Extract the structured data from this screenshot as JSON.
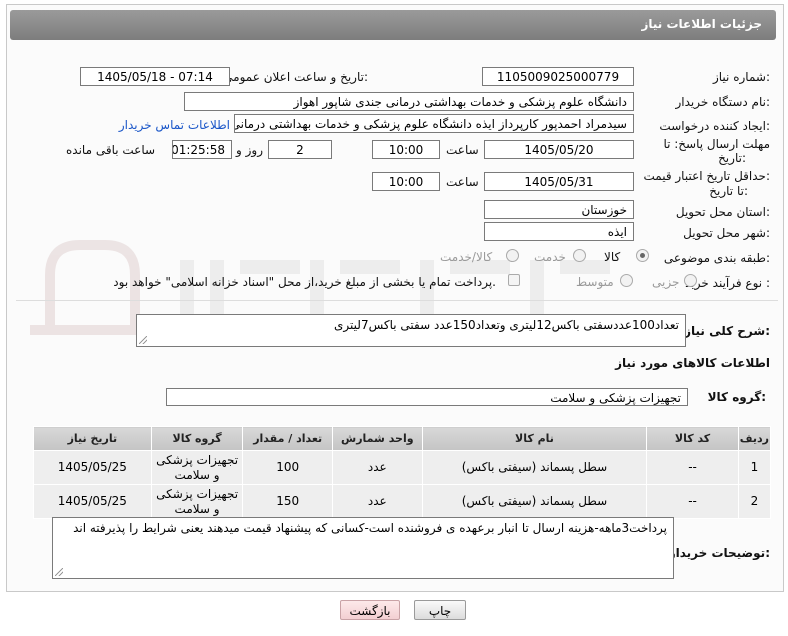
{
  "header": {
    "title": "جزئیات اطلاعات نیاز"
  },
  "fields": {
    "need_number_label": "شماره نیاز:",
    "need_number": "1105009025000779",
    "announce_label": "تاریخ و ساعت اعلان عمومی:",
    "announce_value": "1405/05/18 - 07:14",
    "buyer_org_label": "نام دستگاه خریدار:",
    "buyer_org": "دانشگاه علوم پزشکی و خدمات بهداشتی درمانی جندی شاپور اهواز",
    "requester_label": "ایجاد کننده درخواست:",
    "requester": "سیدمراد احمدپور کارپرداز ایذه دانشگاه علوم پزشکی و خدمات بهداشتی درمانی",
    "contact_link": "اطلاعات تماس خریدار",
    "deadline_label_1": "مهلت ارسال پاسخ: تا",
    "deadline_label_2": "تاریخ:",
    "deadline_date": "1405/05/20",
    "time_label": "ساعت",
    "deadline_time": "10:00",
    "days_value": "2",
    "days_label": "روز و",
    "remaining_time": "01:25:58",
    "remaining_label": "ساعت باقی مانده",
    "validity_label_1": "حداقل تاریخ اعتبار قیمت:",
    "validity_label_2": "تا تاریخ:",
    "validity_date": "1405/05/31",
    "validity_time": "10:00",
    "province_label": "استان محل تحویل:",
    "province": "خوزستان",
    "city_label": "شهر محل تحویل:",
    "city": "ایذه",
    "category_label": "طبقه بندی موضوعی:",
    "category_options": [
      "کالا",
      "خدمت",
      "کالا/خدمت"
    ],
    "process_label": "نوع فرآیند خرید :",
    "process_options": [
      "جزیی",
      "متوسط"
    ],
    "payment_note": "پرداخت تمام یا بخشی از مبلغ خرید،از محل \"اسناد خزانه اسلامی\" خواهد بود."
  },
  "summary": {
    "label": "شرح کلی نیاز:",
    "text": "تعداد100عددسفتی باکس12لیتری وتعداد150عدد سفتی باکس7لیتری"
  },
  "items_section": {
    "title": "اطلاعات کالاهای مورد نیاز",
    "group_label": "گروه کالا:",
    "group_value": "تجهیزات پزشکی و سلامت"
  },
  "table": {
    "headers": [
      "ردیف",
      "کد کالا",
      "نام کالا",
      "واحد شمارش",
      "تعداد / مقدار",
      "گروه کالا",
      "تاریخ نیاز"
    ],
    "rows": [
      [
        "1",
        "--",
        "سطل پسماند (سیفتی باکس)",
        "عدد",
        "100",
        "تجهیزات پزشکی و سلامت",
        "1405/05/25"
      ],
      [
        "2",
        "--",
        "سطل پسماند (سیفتی باکس)",
        "عدد",
        "150",
        "تجهیزات پزشکی و سلامت",
        "1405/05/25"
      ]
    ]
  },
  "buyer_notes": {
    "label": "توضیحات خریدار:",
    "text": "پرداخت3ماهه-هزینه ارسال تا انبار برعهده ی فروشنده است-کسانی که پیشنهاد قیمت میدهند یعنی شرایط را پذیرفته اند"
  },
  "buttons": {
    "print": "چاپ",
    "back": "بازگشت"
  },
  "colors": {
    "header_bg": "#8c8c8c",
    "link": "#1a56c8"
  }
}
